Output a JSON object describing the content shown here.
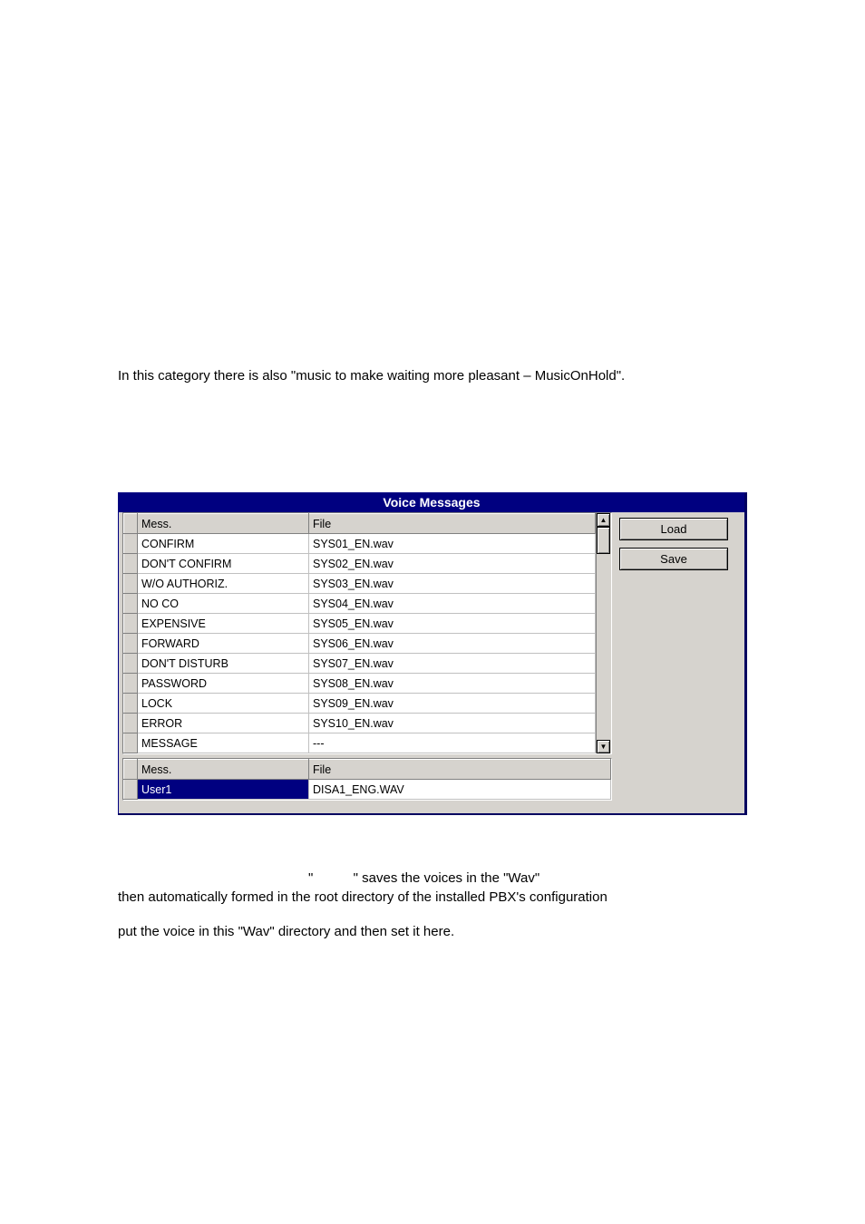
{
  "intro": "In this category there is also \"music to make waiting more pleasant – MusicOnHold\".",
  "panel": {
    "title": "Voice Messages",
    "buttons": {
      "load": "Load",
      "save": "Save"
    },
    "grid1": {
      "headers": {
        "mess": "Mess.",
        "file": "File"
      },
      "rows": [
        {
          "mess": "CONFIRM",
          "file": "SYS01_EN.wav"
        },
        {
          "mess": "DON'T CONFIRM",
          "file": "SYS02_EN.wav"
        },
        {
          "mess": "W/O AUTHORIZ.",
          "file": "SYS03_EN.wav"
        },
        {
          "mess": "NO CO",
          "file": "SYS04_EN.wav"
        },
        {
          "mess": "EXPENSIVE",
          "file": "SYS05_EN.wav"
        },
        {
          "mess": "FORWARD",
          "file": "SYS06_EN.wav"
        },
        {
          "mess": "DON'T DISTURB",
          "file": "SYS07_EN.wav"
        },
        {
          "mess": "PASSWORD",
          "file": "SYS08_EN.wav"
        },
        {
          "mess": "LOCK",
          "file": "SYS09_EN.wav"
        },
        {
          "mess": "ERROR",
          "file": "SYS10_EN.wav"
        },
        {
          "mess": "MESSAGE",
          "file": "---"
        }
      ]
    },
    "grid2": {
      "headers": {
        "mess": "Mess.",
        "file": "File"
      },
      "rows": [
        {
          "mess": "User1",
          "file": "DISA1_ENG.WAV"
        }
      ]
    }
  },
  "after": {
    "line1a": "\"",
    "line1b": "\" saves the voices in the \"Wav\"",
    "line2": "then automatically formed in the root directory of the installed PBX's configuration",
    "line3": "put the voice in this \"Wav\" directory and then set it here."
  }
}
